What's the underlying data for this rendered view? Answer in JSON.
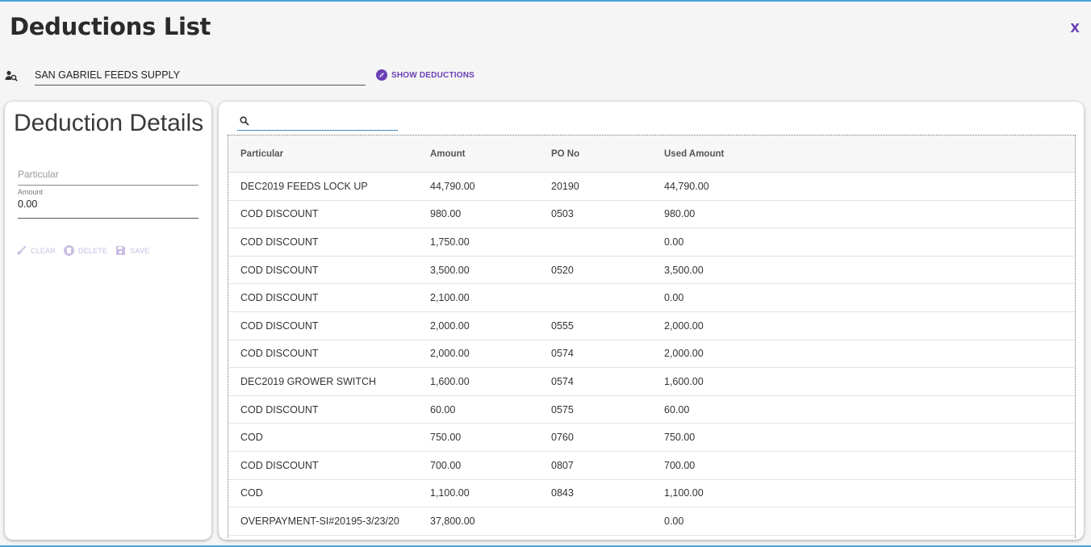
{
  "window": {
    "title": "Deductions List",
    "close_label": "X"
  },
  "customer": {
    "value": "SAN GABRIEL FEEDS SUPPLY",
    "show_button": "SHOW DEDUCTIONS"
  },
  "details": {
    "title": "Deduction Details",
    "particular_placeholder": "Particular",
    "amount_label": "Amount",
    "amount_value": "0.00",
    "actions": {
      "clear": "CLEAR",
      "delete": "DELETE",
      "save": "SAVE"
    }
  },
  "table": {
    "columns": [
      "Particular",
      "Amount",
      "PO No",
      "Used Amount"
    ],
    "rows": [
      [
        "DEC2019 FEEDS LOCK UP",
        "44,790.00",
        "20190",
        "44,790.00"
      ],
      [
        "COD DISCOUNT",
        "980.00",
        "0503",
        "980.00"
      ],
      [
        "COD DISCOUNT",
        "1,750.00",
        "",
        "0.00"
      ],
      [
        "COD DISCOUNT",
        "3,500.00",
        "0520",
        "3,500.00"
      ],
      [
        "COD DISCOUNT",
        "2,100.00",
        "",
        "0.00"
      ],
      [
        "COD DISCOUNT",
        "2,000.00",
        "0555",
        "2,000.00"
      ],
      [
        "COD DISCOUNT",
        "2,000.00",
        "0574",
        "2,000.00"
      ],
      [
        "DEC2019 GROWER SWITCH",
        "1,600.00",
        "0574",
        "1,600.00"
      ],
      [
        "COD DISCOUNT",
        "60.00",
        "0575",
        "60.00"
      ],
      [
        "COD",
        "750.00",
        "0760",
        "750.00"
      ],
      [
        "COD DISCOUNT",
        "700.00",
        "0807",
        "700.00"
      ],
      [
        "COD",
        "1,100.00",
        "0843",
        "1,100.00"
      ],
      [
        "OVERPAYMENT-SI#20195-3/23/20",
        "37,800.00",
        "",
        "0.00"
      ]
    ]
  },
  "colors": {
    "accent": "#6a3fb5",
    "frame": "#4aa3d8",
    "disabled": "#c9bde2"
  }
}
